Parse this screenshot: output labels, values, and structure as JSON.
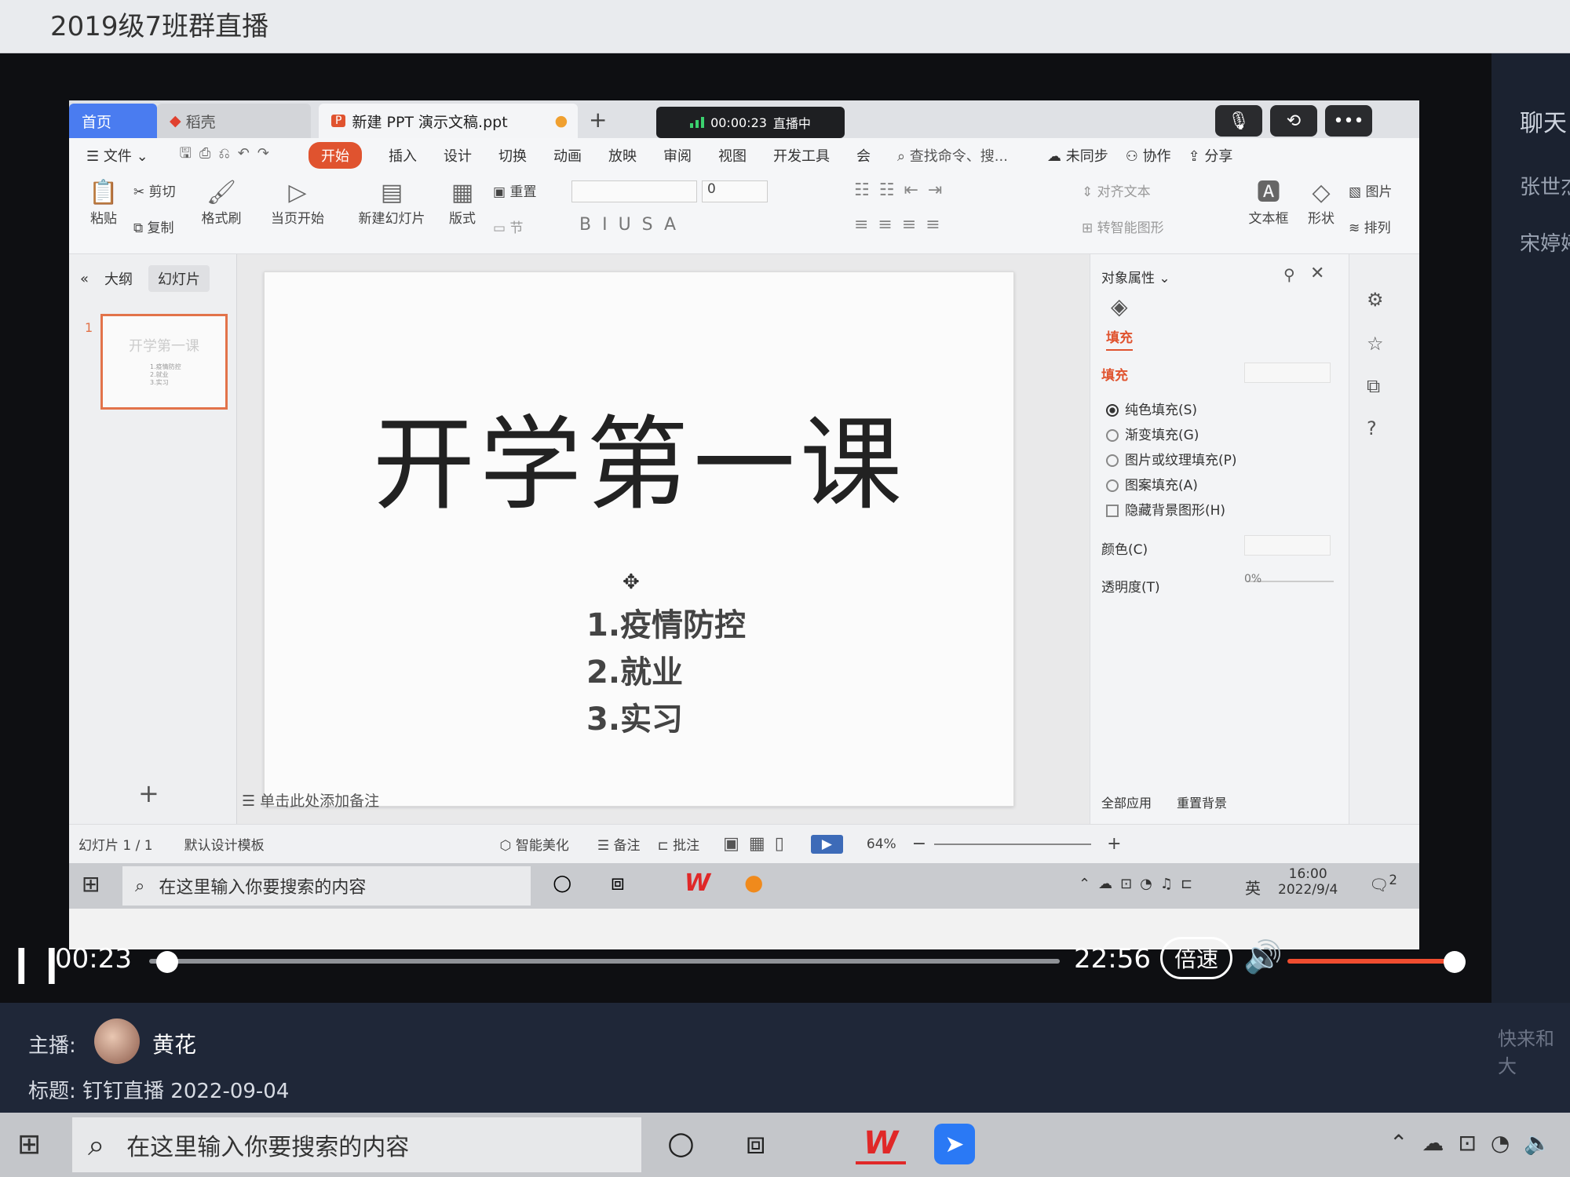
{
  "window": {
    "title": "2019级7班群直播"
  },
  "side_panel": {
    "title": "聊天",
    "users": [
      "张世杰",
      "宋婷婷"
    ],
    "chat_hint": "快来和大"
  },
  "ppt": {
    "tabs": {
      "home": "首页",
      "daoke": "稻壳",
      "doc": "新建 PPT 演示文稿.ppt",
      "add": "+"
    },
    "live": {
      "time": "00:00:23",
      "status": "直播中"
    },
    "menu": {
      "file": "文件",
      "items": [
        "开始",
        "插入",
        "设计",
        "切换",
        "动画",
        "放映",
        "审阅",
        "视图",
        "开发工具",
        "会"
      ],
      "search": "查找命令、搜...",
      "sync": "未同步",
      "collab": "协作",
      "share": "分享"
    },
    "ribbon": {
      "paste": "粘贴",
      "cut": "剪切",
      "copy": "复制",
      "format_painter": "格式刷",
      "play_current": "当页开始",
      "new_slide": "新建幻灯片",
      "layout": "版式",
      "reset": "重置",
      "section": "节",
      "font_size": "0",
      "align_text": "对齐文本",
      "smart_shape": "转智能图形",
      "textbox": "文本框",
      "shape": "形状",
      "picture": "图片",
      "arrange": "排列"
    },
    "left_panel": {
      "tab_outline": "大纲",
      "tab_slides": "幻灯片",
      "slide_number": "1",
      "add": "+"
    },
    "slide": {
      "title": "开学第一课",
      "items": [
        "1.疫情防控",
        "2.就业",
        "3.实习"
      ]
    },
    "notes_hint": "单击此处添加备注",
    "props": {
      "header": "对象属性",
      "tab_fill": "填充",
      "section": "填充",
      "options": [
        "纯色填充(S)",
        "渐变填充(G)",
        "图片或纹理填充(P)",
        "图案填充(A)"
      ],
      "hide_bg": "隐藏背景图形(H)",
      "color": "颜色(C)",
      "transparency": "透明度(T)",
      "transparency_value": "0%",
      "apply_all": "全部应用",
      "reset_bg": "重置背景"
    },
    "status": {
      "slide_info": "幻灯片 1 / 1",
      "template": "默认设计模板",
      "beautify": "智能美化",
      "notes": "备注",
      "comment": "批注",
      "zoom": "64%"
    },
    "taskbar": {
      "search": "在这里输入你要搜索的内容",
      "time": "16:00",
      "date": "2022/9/4",
      "ime": "英",
      "notif": "2"
    }
  },
  "player": {
    "current": "00:23",
    "duration": "22:56",
    "speed": "倍速",
    "progress": 0.02,
    "volume": 0.96
  },
  "info": {
    "host_label": "主播:",
    "host_name": "黄花",
    "subject": "标题: 钉钉直播 2022-09-04"
  },
  "taskbar": {
    "search": "在这里输入你要搜索的内容"
  }
}
